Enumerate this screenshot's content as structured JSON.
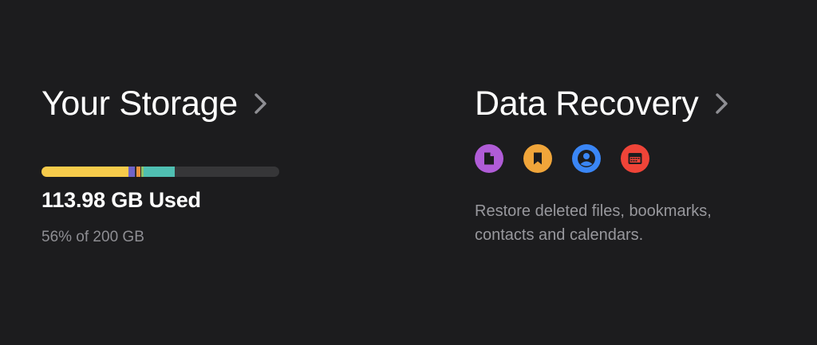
{
  "storage": {
    "title": "Your Storage",
    "used_label": "113.98 GB Used",
    "percent_label": "56% of 200 GB",
    "used_fraction": 0.56,
    "segments": [
      {
        "category": "primary",
        "color": "#f6cb4b",
        "fraction": 0.365
      },
      {
        "category": "purple",
        "color": "#6e63c9",
        "fraction": 0.027
      },
      {
        "category": "dark",
        "color": "#2b2b2e",
        "fraction": 0.007
      },
      {
        "category": "orange",
        "color": "#e9913a",
        "fraction": 0.017
      },
      {
        "category": "dark",
        "color": "#2b2b2e",
        "fraction": 0.004
      },
      {
        "category": "green",
        "color": "#8cc46b",
        "fraction": 0.01
      },
      {
        "category": "teal",
        "color": "#4fbfb2",
        "fraction": 0.13
      }
    ]
  },
  "recovery": {
    "title": "Data Recovery",
    "description_lines": [
      "Restore deleted files, bookmarks,",
      "contacts and calendars."
    ],
    "icons": [
      {
        "name": "file-icon",
        "color": "#b05cd7"
      },
      {
        "name": "bookmark-icon",
        "color": "#f0a53a"
      },
      {
        "name": "contacts-icon",
        "color": "#3a86f6"
      },
      {
        "name": "calendar-icon",
        "color": "#ef4438"
      }
    ]
  },
  "colors": {
    "background": "#1c1c1e",
    "text_primary": "#ffffff",
    "text_secondary": "#8e8e93",
    "bar_track": "#363638",
    "chevron": "#8e8e93"
  }
}
